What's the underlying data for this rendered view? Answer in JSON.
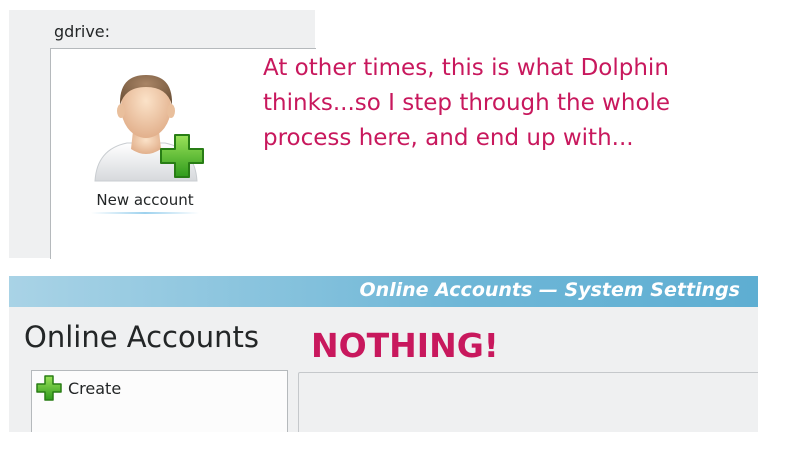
{
  "dolphin": {
    "location": "gdrive:",
    "item": {
      "label": "New account",
      "icon": "user-add-icon"
    }
  },
  "annotation": {
    "text": "At other times, this is what Dolphin thinks...so I step through the whole process here, and end up with...",
    "color": "#c8185d"
  },
  "settings": {
    "window_title": "Online Accounts — System Settings",
    "page_heading": "Online Accounts",
    "nothing_label": "NOTHING!",
    "create_label": "Create",
    "create_icon": "green-plus-icon",
    "titlebar_color": "#6fb7d7"
  }
}
